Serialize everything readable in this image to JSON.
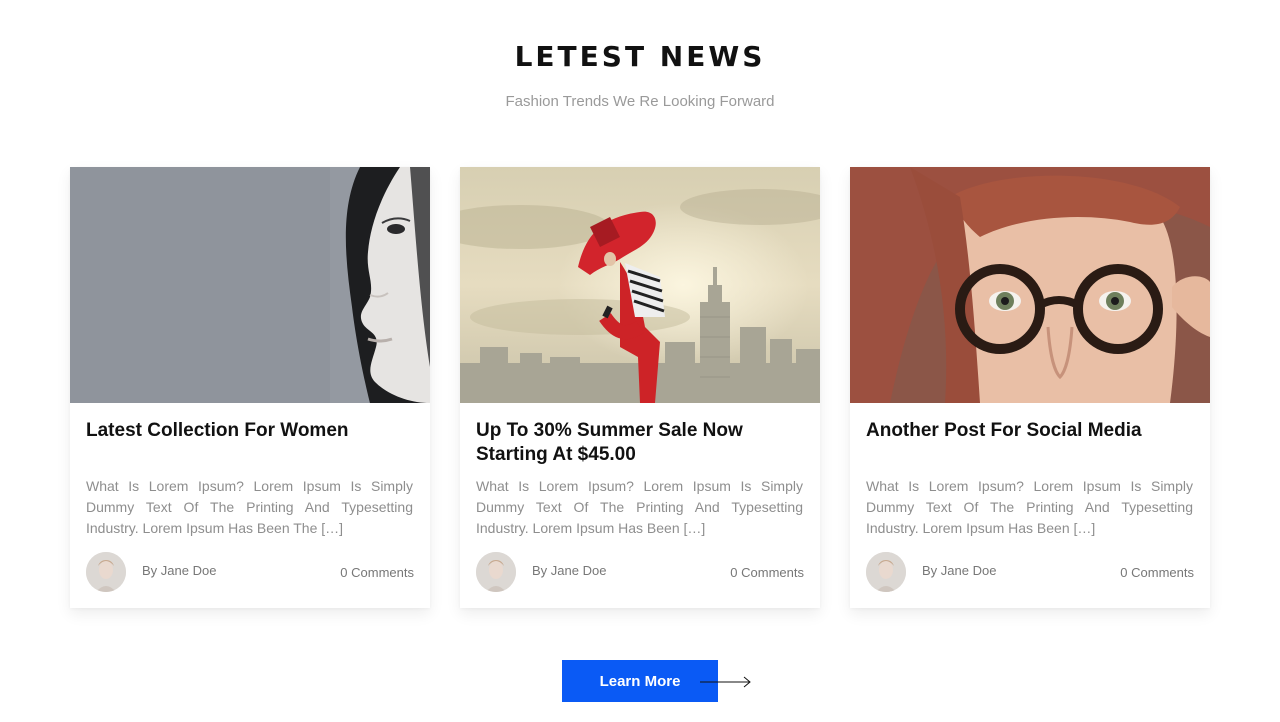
{
  "section": {
    "title": "LETEST NEWS",
    "subtitle": "Fashion Trends We Re Looking Forward"
  },
  "posts": [
    {
      "title": "Latest Collection For Women",
      "excerpt": "What Is Lorem Ipsum? Lorem Ipsum Is Simply Dummy Text Of The Printing And Typesetting Industry. Lorem Ipsum Has Been The […]",
      "author": "By Jane Doe",
      "comments": "0 Comments",
      "image": "woman-profile-grayscale-photo"
    },
    {
      "title": "Up To 30% Summer Sale Now Starting At $45.00",
      "excerpt": "What Is Lorem Ipsum? Lorem Ipsum Is Simply Dummy Text Of The Printing And Typesetting Industry. Lorem Ipsum Has Been […]",
      "author": "By Jane Doe",
      "comments": "0 Comments",
      "image": "dancer-with-red-scarf-city-photo"
    },
    {
      "title": "Another Post For Social Media",
      "excerpt": "What Is Lorem Ipsum? Lorem Ipsum Is Simply Dummy Text Of The Printing And Typesetting Industry. Lorem Ipsum Has Been […]",
      "author": "By Jane Doe",
      "comments": "0 Comments",
      "image": "woman-with-glasses-photo"
    }
  ],
  "cta": {
    "label": "Learn More",
    "icon": "arrow-right-icon"
  },
  "colors": {
    "accent": "#0a5af5",
    "text": "#111111",
    "muted": "#8e8e8e"
  }
}
